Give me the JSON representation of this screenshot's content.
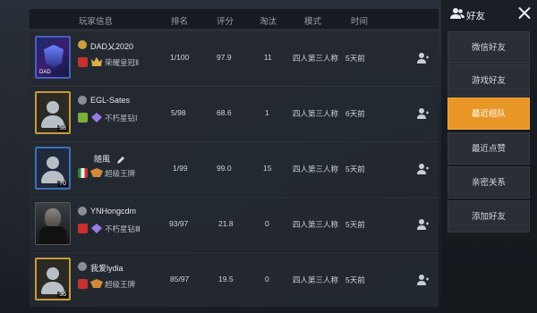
{
  "header": {
    "player_info": "玩家信息",
    "rank": "排名",
    "score": "评分",
    "eliminated": "淘汰",
    "mode": "模式",
    "time": "时间"
  },
  "rows": [
    {
      "name": "DAD乂2020",
      "tier": "荣耀皇冠Ⅱ",
      "rank": "1/100",
      "score": "97.9",
      "elim": "11",
      "mode": "四人第三人称",
      "time": "5天前",
      "avatar_tag": "DAD"
    },
    {
      "name": "EGL-Sates",
      "tier": "不朽星钻Ⅰ",
      "rank": "5/98",
      "score": "68.6",
      "elim": "1",
      "mode": "四人第三人称",
      "time": "6天前",
      "avatar_level": "58"
    },
    {
      "name": "随風",
      "tier": "超级王牌",
      "rank": "1/99",
      "score": "99.0",
      "elim": "15",
      "mode": "四人第三人称",
      "time": "5天前",
      "avatar_level": "70"
    },
    {
      "name": "YNHongcdm",
      "tier": "不朽星钻Ⅲ",
      "rank": "93/97",
      "score": "21.8",
      "elim": "0",
      "mode": "四人第三人称",
      "time": "5天前",
      "avatar_level": ""
    },
    {
      "name": "我爱lydia",
      "tier": "超级王牌",
      "rank": "85/97",
      "score": "19.5",
      "elim": "0",
      "mode": "四人第三人称",
      "time": "5天前",
      "avatar_level": "36"
    }
  ],
  "sidebar": {
    "title": "好友",
    "items": [
      "微信好友",
      "游戏好友",
      "最近组队",
      "最近点赞",
      "亲密关系",
      "添加好友"
    ],
    "active_index": 2
  },
  "colors": {
    "accent": "#e89626",
    "gold_frame": "#c89a3c",
    "blue_frame": "#3d6fb8"
  },
  "icons": [
    "friends-icon",
    "close-icon",
    "add-friend-icon",
    "rank-badge-icon",
    "tier-icon",
    "edit-icon"
  ]
}
